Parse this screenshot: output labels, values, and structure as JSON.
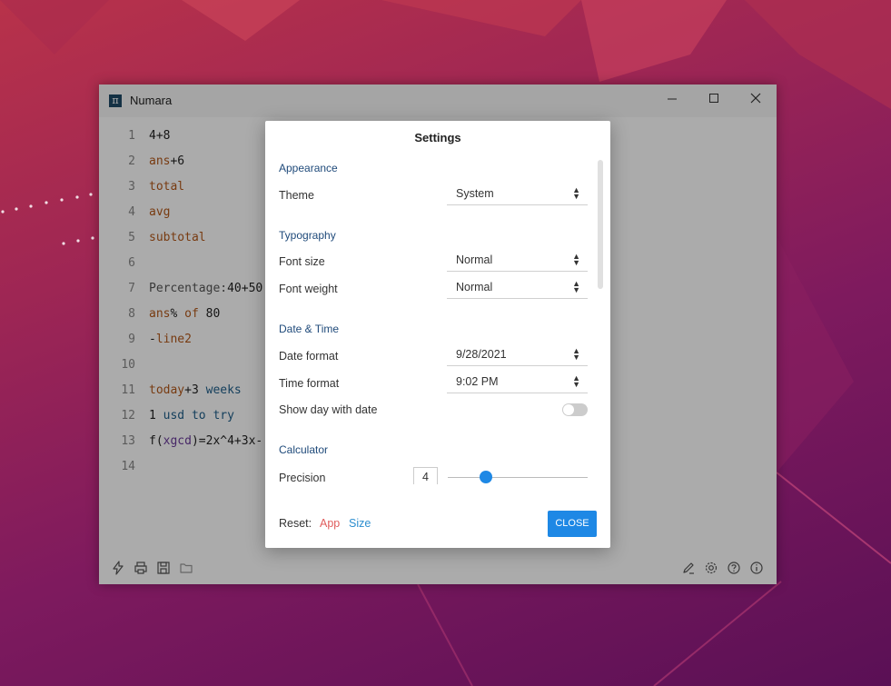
{
  "window": {
    "title": "Numara",
    "icon_glyph": "π"
  },
  "editor": {
    "lines": [
      {
        "n": "1",
        "parts": [
          [
            "4+8",
            "c-num"
          ]
        ]
      },
      {
        "n": "2",
        "parts": [
          [
            "ans",
            "c-kw"
          ],
          [
            "+6",
            "c-num"
          ]
        ]
      },
      {
        "n": "3",
        "parts": [
          [
            "total",
            "c-kw"
          ]
        ]
      },
      {
        "n": "4",
        "parts": [
          [
            "avg",
            "c-kw"
          ]
        ]
      },
      {
        "n": "5",
        "parts": [
          [
            "subtotal",
            "c-kw"
          ]
        ]
      },
      {
        "n": "6",
        "parts": []
      },
      {
        "n": "7",
        "parts": [
          [
            "Percentage:",
            "c-grey"
          ],
          [
            "40+50",
            "c-num"
          ]
        ]
      },
      {
        "n": "8",
        "parts": [
          [
            "ans",
            "c-kw"
          ],
          [
            "% ",
            "c-num"
          ],
          [
            "of",
            "c-kw"
          ],
          [
            " 80",
            "c-num"
          ]
        ]
      },
      {
        "n": "9",
        "parts": [
          [
            "-",
            "c-num"
          ],
          [
            "line2",
            "c-kw"
          ]
        ]
      },
      {
        "n": "10",
        "parts": []
      },
      {
        "n": "11",
        "parts": [
          [
            "today",
            "c-kw"
          ],
          [
            "+3 ",
            "c-num"
          ],
          [
            "weeks",
            "c-key"
          ]
        ]
      },
      {
        "n": "12",
        "parts": [
          [
            "1 ",
            "c-num"
          ],
          [
            "usd",
            "c-key"
          ],
          [
            " ",
            "c-num"
          ],
          [
            "to",
            "c-key"
          ],
          [
            " ",
            "c-num"
          ],
          [
            "try",
            "c-key"
          ]
        ]
      },
      {
        "n": "13",
        "parts": [
          [
            "f(",
            "c-num"
          ],
          [
            "xgcd",
            "c-var"
          ],
          [
            ")=2x^4+3x-",
            "c-num"
          ]
        ]
      },
      {
        "n": "14",
        "parts": []
      }
    ]
  },
  "statusbar": {
    "left_icons": [
      "lightning-icon",
      "print-icon",
      "save-icon",
      "folder-icon"
    ],
    "right_icons": [
      "pen-icon",
      "gear-icon",
      "help-icon",
      "info-icon"
    ]
  },
  "settings": {
    "title": "Settings",
    "sections": {
      "appearance": "Appearance",
      "typography": "Typography",
      "datetime": "Date & Time",
      "calculator": "Calculator"
    },
    "theme": {
      "label": "Theme",
      "value": "System"
    },
    "font_size": {
      "label": "Font size",
      "value": "Normal"
    },
    "font_weight": {
      "label": "Font weight",
      "value": "Normal"
    },
    "date_format": {
      "label": "Date format",
      "value": "9/28/2021"
    },
    "time_format": {
      "label": "Time format",
      "value": "9:02 PM"
    },
    "show_day": {
      "label": "Show day with date",
      "checked": false
    },
    "precision": {
      "label": "Precision",
      "value": "4",
      "slider_fraction": 0.27
    },
    "reset": {
      "label": "Reset:",
      "app": "App",
      "size": "Size"
    },
    "close": "CLOSE"
  },
  "colors": {
    "accent": "#1e88e5",
    "reset_app": "#e05c5c",
    "reset_size": "#2c8ecf"
  }
}
